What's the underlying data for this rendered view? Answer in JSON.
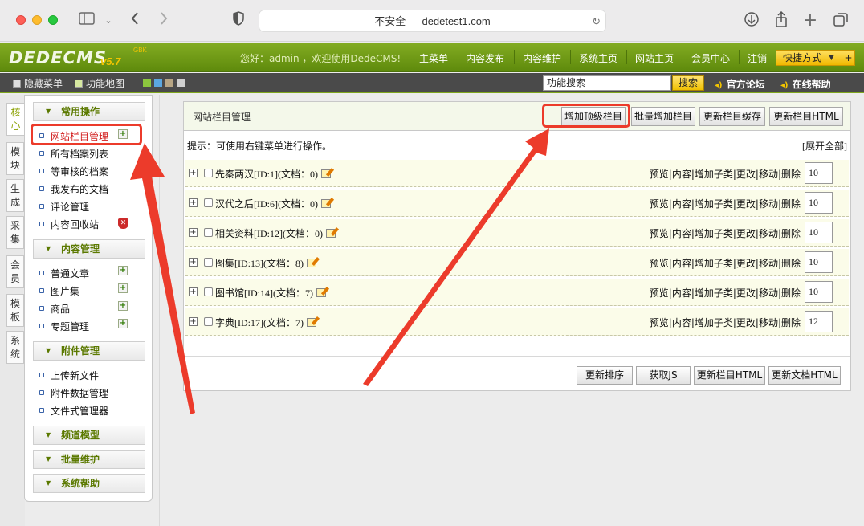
{
  "browser": {
    "url_text": "不安全 — dedetest1.com"
  },
  "header": {
    "logo": "DEDECMS",
    "logo_version": "v5.7",
    "logo_edition": "GBK",
    "welcome": "您好：admin ，欢迎使用DedeCMS!",
    "nav": [
      "主菜单",
      "内容发布",
      "内容维护",
      "系统主页",
      "网站主页",
      "会员中心",
      "注销"
    ],
    "quick_label": "快捷方式",
    "quick_plus": "+"
  },
  "subbar": {
    "hide_menu": "隐藏菜单",
    "site_map": "功能地图",
    "search_value": "功能搜索",
    "search_btn": "搜索",
    "forum": "官方论坛",
    "help": "在线帮助"
  },
  "side_tabs": [
    "核心",
    "模块",
    "生成",
    "采集",
    "会员",
    "模板",
    "系统"
  ],
  "menu": {
    "sec_common": "常用操作",
    "common": [
      "网站栏目管理",
      "所有档案列表",
      "等审核的档案",
      "我发布的文档",
      "评论管理",
      "内容回收站"
    ],
    "sec_content": "内容管理",
    "content": [
      "普通文章",
      "图片集",
      "商品",
      "专题管理"
    ],
    "sec_attach": "附件管理",
    "attach": [
      "上传新文件",
      "附件数据管理",
      "文件式管理器"
    ],
    "sec_channel": "频道模型",
    "sec_batch": "批量维护",
    "sec_help": "系统帮助"
  },
  "panel": {
    "title": "网站栏目管理",
    "btn_add_top": "增加顶级栏目",
    "btn_batch_add": "批量增加栏目",
    "btn_update_cache": "更新栏目缓存",
    "btn_update_html": "更新栏目HTML",
    "tip": "提示：可使用右键菜单进行操作。",
    "expand_all": "[展开全部]",
    "ops": "预览|内容|增加子类|更改|移动|删除",
    "rows": [
      {
        "name": "先秦两汉[ID:1](文档：0)",
        "order": "10"
      },
      {
        "name": "汉代之后[ID:6](文档：0)",
        "order": "10"
      },
      {
        "name": "相关资料[ID:12](文档：0)",
        "order": "10"
      },
      {
        "name": "图集[ID:13](文档：8)",
        "order": "10"
      },
      {
        "name": "图书馆[ID:14](文档：7)",
        "order": "10"
      },
      {
        "name": "字典[ID:17](文档：7)",
        "order": "12"
      }
    ],
    "footer_btns": [
      "更新排序",
      "获取JS",
      "更新栏目HTML",
      "更新文档HTML"
    ]
  },
  "colors": {
    "accent_green": "#6b9614",
    "highlight_red": "#ec3b2b",
    "quick_yellow": "#f2c400"
  }
}
